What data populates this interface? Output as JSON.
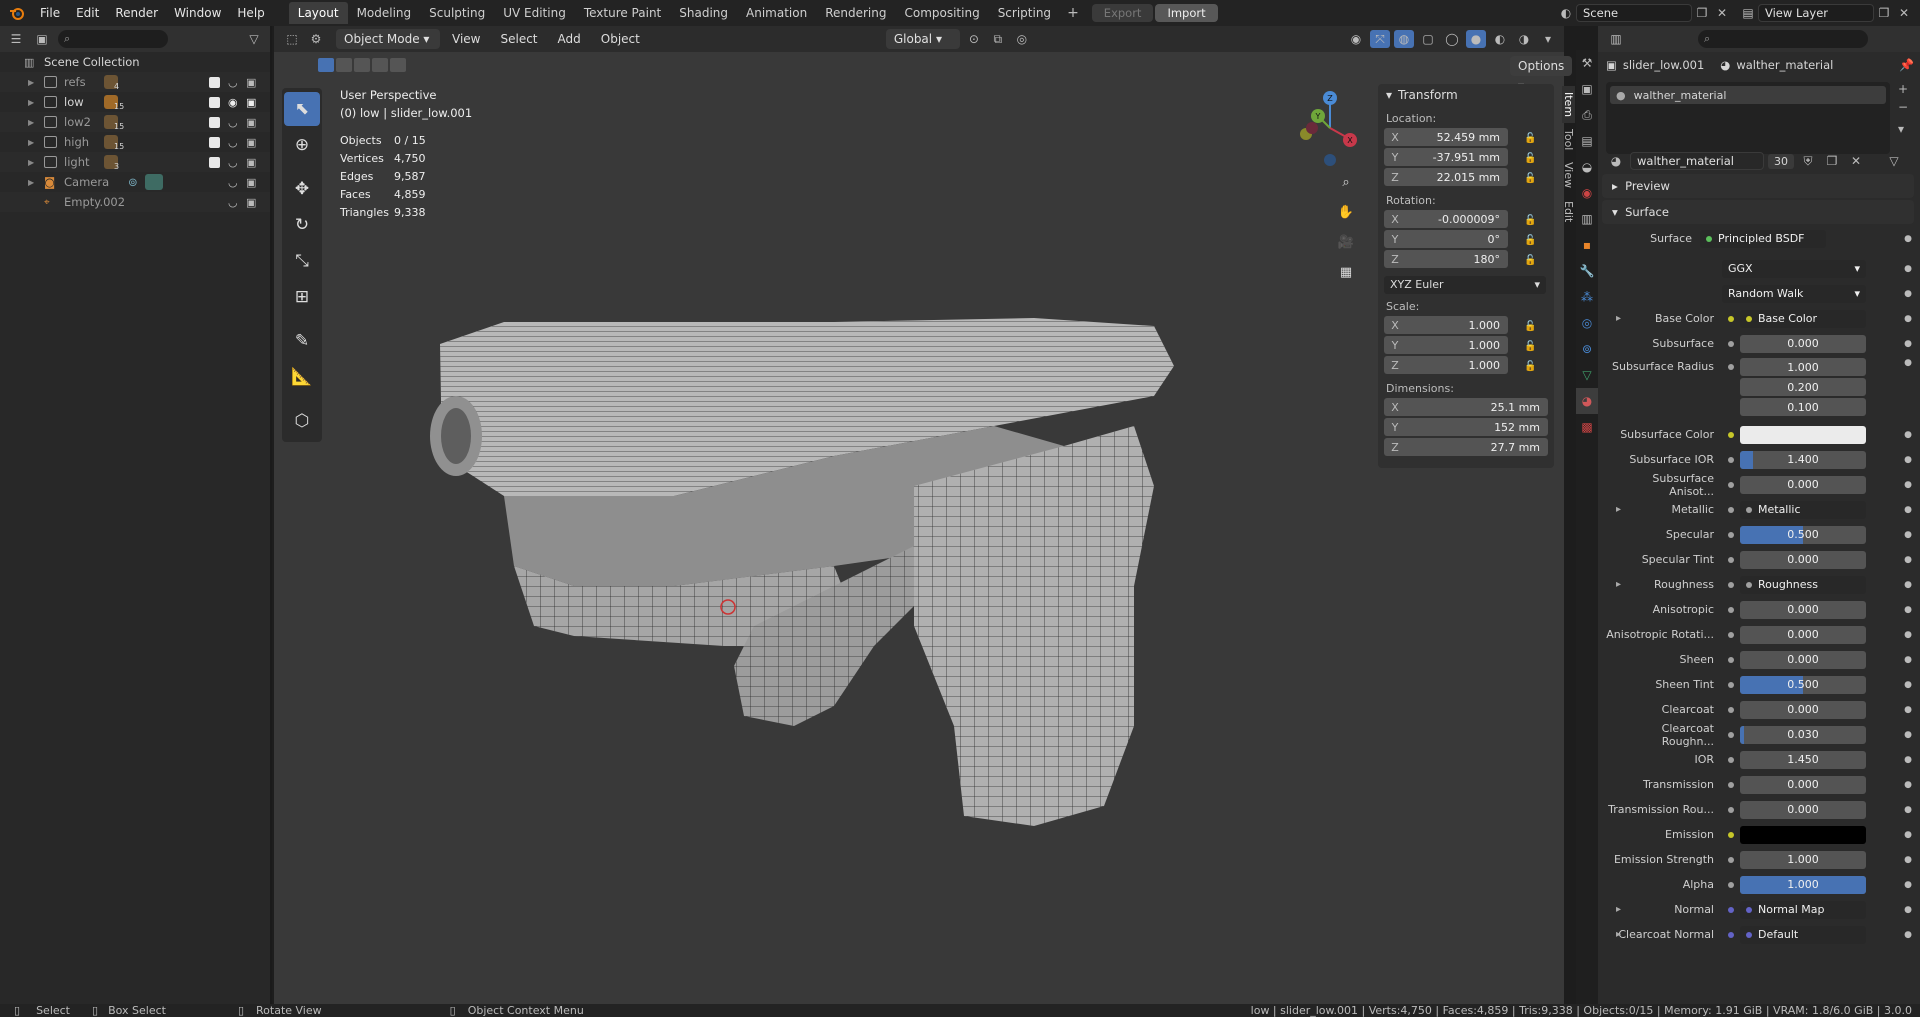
{
  "topbar": {
    "menus": [
      "File",
      "Edit",
      "Render",
      "Window",
      "Help"
    ],
    "workspaces": [
      "Layout",
      "Modeling",
      "Sculpting",
      "UV Editing",
      "Texture Paint",
      "Shading",
      "Animation",
      "Rendering",
      "Compositing",
      "Scripting"
    ],
    "active_workspace": "Layout",
    "export_label": "Export",
    "import_label": "Import",
    "scene": "Scene",
    "view_layer": "View Layer"
  },
  "outliner": {
    "root": "Scene Collection",
    "items": [
      {
        "name": "refs",
        "badge": "4"
      },
      {
        "name": "low",
        "badge": "15"
      },
      {
        "name": "low2",
        "badge": "15"
      },
      {
        "name": "high",
        "badge": "15"
      },
      {
        "name": "light",
        "badge": "3"
      },
      {
        "name": "Camera",
        "badge": ""
      },
      {
        "name": "Empty.002",
        "badge": ""
      }
    ]
  },
  "viewport": {
    "mode": "Object Mode",
    "menus": [
      "View",
      "Select",
      "Add",
      "Object"
    ],
    "orientation": "Global",
    "options": "Options",
    "perspective": "User Perspective",
    "context": "(0) low | slider_low.001",
    "stats": [
      {
        "label": "Objects",
        "value": "0 / 15"
      },
      {
        "label": "Vertices",
        "value": "4,750"
      },
      {
        "label": "Edges",
        "value": "9,587"
      },
      {
        "label": "Faces",
        "value": "4,859"
      },
      {
        "label": "Triangles",
        "value": "9,338"
      }
    ]
  },
  "npanel": {
    "title": "Transform",
    "location_label": "Location:",
    "location": {
      "x": "52.459 mm",
      "y": "-37.951 mm",
      "z": "22.015 mm"
    },
    "rotation_label": "Rotation:",
    "rotation": {
      "x": "-0.000009°",
      "y": "0°",
      "z": "180°"
    },
    "rotation_mode": "XYZ Euler",
    "scale_label": "Scale:",
    "scale": {
      "x": "1.000",
      "y": "1.000",
      "z": "1.000"
    },
    "dimensions_label": "Dimensions:",
    "dimensions": {
      "x": "25.1 mm",
      "y": "152 mm",
      "z": "27.7 mm"
    },
    "tabs": [
      "Item",
      "Tool",
      "View",
      "Edit"
    ],
    "axis": [
      "X",
      "Y",
      "Z"
    ]
  },
  "properties": {
    "object": "slider_low.001",
    "material": "walther_material",
    "slot": "walther_material",
    "users": "30",
    "sections": {
      "preview": "Preview",
      "surface": "Surface"
    },
    "surface_shader": "Principled BSDF",
    "distribution": "GGX",
    "subsurface_method": "Random Walk",
    "rows": [
      {
        "label": "Base Color",
        "kind": "link",
        "value": "Base Color",
        "dot": "#c7c729"
      },
      {
        "label": "Subsurface",
        "kind": "num",
        "value": "0.000",
        "fill": 0
      },
      {
        "label": "Subsurface Radius",
        "kind": "vec",
        "value": "1.000",
        "v2": "0.200",
        "v3": "0.100"
      },
      {
        "label": "Subsurface Color",
        "kind": "color",
        "value": "",
        "color": "#ebebeb"
      },
      {
        "label": "Subsurface IOR",
        "kind": "num",
        "value": "1.400",
        "fill": 0.1
      },
      {
        "label": "Subsurface Anisot...",
        "kind": "num",
        "value": "0.000",
        "fill": 0
      },
      {
        "label": "Metallic",
        "kind": "link",
        "value": "Metallic",
        "dot": "#a0a0a0"
      },
      {
        "label": "Specular",
        "kind": "num",
        "value": "0.500",
        "fill": 0.5
      },
      {
        "label": "Specular Tint",
        "kind": "num",
        "value": "0.000",
        "fill": 0
      },
      {
        "label": "Roughness",
        "kind": "link",
        "value": "Roughness",
        "dot": "#a0a0a0"
      },
      {
        "label": "Anisotropic",
        "kind": "num",
        "value": "0.000",
        "fill": 0
      },
      {
        "label": "Anisotropic Rotati...",
        "kind": "num",
        "value": "0.000",
        "fill": 0
      },
      {
        "label": "Sheen",
        "kind": "num",
        "value": "0.000",
        "fill": 0
      },
      {
        "label": "Sheen Tint",
        "kind": "num",
        "value": "0.500",
        "fill": 0.5
      },
      {
        "label": "Clearcoat",
        "kind": "num",
        "value": "0.000",
        "fill": 0
      },
      {
        "label": "Clearcoat Roughn...",
        "kind": "num",
        "value": "0.030",
        "fill": 0.03
      },
      {
        "label": "IOR",
        "kind": "num",
        "value": "1.450",
        "fill": 0
      },
      {
        "label": "Transmission",
        "kind": "num",
        "value": "0.000",
        "fill": 0
      },
      {
        "label": "Transmission Rou...",
        "kind": "num",
        "value": "0.000",
        "fill": 0
      },
      {
        "label": "Emission",
        "kind": "color",
        "value": "",
        "color": "#000000"
      },
      {
        "label": "Emission Strength",
        "kind": "num",
        "value": "1.000",
        "fill": 0
      },
      {
        "label": "Alpha",
        "kind": "num",
        "value": "1.000",
        "fill": 1
      },
      {
        "label": "Normal",
        "kind": "link",
        "value": "Normal Map",
        "dot": "#6363c7"
      },
      {
        "label": "Clearcoat Normal",
        "kind": "link",
        "value": "Default",
        "dot": "#6363c7"
      }
    ]
  },
  "statusbar": {
    "select": "Select",
    "box_select": "Box Select",
    "rotate": "Rotate View",
    "context_menu": "Object Context Menu",
    "info": "low | slider_low.001 | Verts:4,750 | Faces:4,859 | Tris:9,338 | Objects:0/15 | Memory: 1.91 GiB | VRAM: 1.8/6.0 GiB | 3.0.0"
  },
  "colors": {
    "accent": "#4772b3",
    "background": "#393939"
  }
}
